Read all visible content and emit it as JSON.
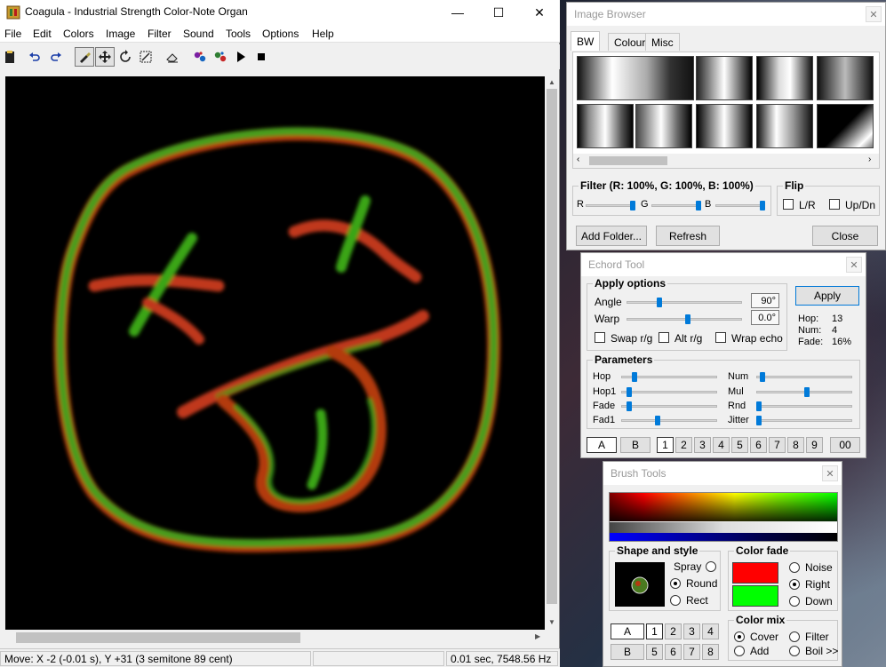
{
  "main": {
    "title": "Coagula - Industrial Strength Color-Note Organ",
    "window_controls": {
      "minimize": "—",
      "maximize": "☐",
      "close": "✕"
    },
    "menu": [
      "File",
      "Edit",
      "Colors",
      "Image",
      "Filter",
      "Sound",
      "Tools",
      "Options",
      "Help"
    ],
    "toolbar_icons": [
      "paste-icon",
      "undo-icon",
      "redo-icon",
      "brush-icon",
      "move-icon",
      "rotate-icon",
      "transform-icon",
      "erase-icon",
      "render-icon",
      "render-noise-icon",
      "play-icon",
      "stop-icon"
    ],
    "status": {
      "position": "Move: X -2 (-0.01 s), Y +31 (3 semitone 89 cent)",
      "middle": "",
      "time_freq": "0.01 sec, 7548.56 Hz"
    }
  },
  "image_browser": {
    "title": "Image Browser",
    "tabs": [
      "BW",
      "Colour",
      "Misc"
    ],
    "active_tab": "BW",
    "filter_label": "Filter (R: 100%, G: 100%, B: 100%)",
    "filter_channels": [
      "R",
      "G",
      "B"
    ],
    "flip_label": "Flip",
    "flip_lr": "L/R",
    "flip_updn": "Up/Dn",
    "add_folder": "Add Folder...",
    "refresh": "Refresh",
    "close": "Close"
  },
  "echord": {
    "title": "Echord Tool",
    "apply_options": "Apply options",
    "angle_label": "Angle",
    "angle_value": "90°",
    "warp_label": "Warp",
    "warp_value": "0.0°",
    "apply": "Apply",
    "swap_rg": "Swap r/g",
    "alt_rg": "Alt r/g",
    "wrap_echo": "Wrap echo",
    "hop_info": "Hop:",
    "hop_val": "13",
    "num_info": "Num:",
    "num_val": "4",
    "fade_info": "Fade:",
    "fade_val": "16%",
    "parameters": "Parameters",
    "params_left": [
      "Hop",
      "Hop1",
      "Fade",
      "Fad1"
    ],
    "params_right": [
      "Num",
      "Mul",
      "Rnd",
      "Jitter"
    ],
    "preset_a": "A",
    "preset_b": "B",
    "presets": [
      "1",
      "2",
      "3",
      "4",
      "5",
      "6",
      "7",
      "8",
      "9"
    ],
    "preset_00": "00"
  },
  "brush": {
    "title": "Brush Tools",
    "shape_style": "Shape and style",
    "spray": "Spray",
    "round": "Round",
    "rect": "Rect",
    "color_fade": "Color fade",
    "noise": "Noise",
    "right": "Right",
    "down": "Down",
    "color_mix": "Color mix",
    "cover": "Cover",
    "filter": "Filter",
    "add": "Add",
    "boil": "Boil >>",
    "preset_a": "A",
    "preset_b": "B",
    "presets_top": [
      "1",
      "2",
      "3",
      "4"
    ],
    "presets_bottom": [
      "5",
      "6",
      "7",
      "8"
    ],
    "fade_colors": {
      "start": "#ff0000",
      "end": "#00ff00"
    }
  }
}
